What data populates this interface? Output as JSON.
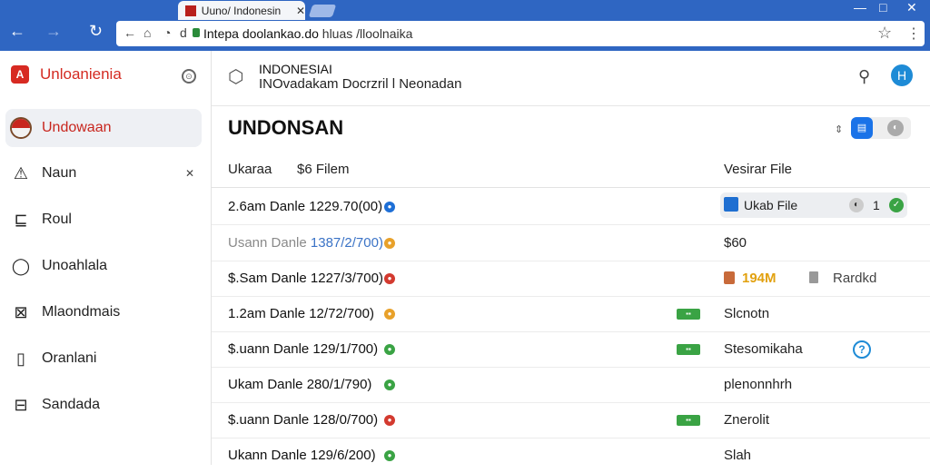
{
  "browser": {
    "tab_title": "Uuno/ Indonesin",
    "url_host": "Intepa doolankao.do",
    "url_path": " hluas /lloolnaika",
    "nav": {
      "back": "←",
      "forward": "→",
      "reload": "↻"
    },
    "window_controls": [
      "—",
      "□",
      "✕"
    ],
    "tab_close": "✕"
  },
  "sidebar": {
    "brand": "Unloanienia",
    "brand_icon": "logo-icon",
    "items": [
      {
        "label": "Undowaan",
        "icon": "flag-icon",
        "active": true
      },
      {
        "label": "Naun",
        "icon": "warning-icon",
        "extra": "✕"
      },
      {
        "label": "Roul",
        "icon": "chart-icon"
      },
      {
        "label": "Unoahlala",
        "icon": "chat-icon"
      },
      {
        "label": "Mlaondmais",
        "icon": "grid-icon"
      },
      {
        "label": "Oranlani",
        "icon": "document-icon"
      },
      {
        "label": "Sandada",
        "icon": "table-icon"
      }
    ]
  },
  "header": {
    "title": "INDONESIAI",
    "subtitle": "INOvadakam Docrzril l Neonadan"
  },
  "page": {
    "title": "UNDONSAN",
    "columns": {
      "name": "Ukaraa",
      "size": "$6 Filem",
      "file": "Vesirar File"
    }
  },
  "rows": [
    {
      "name": "2.6am Danle 1229.70(00)",
      "dot_color": "#1e6fd6",
      "file_chip": {
        "label": "Ukab File",
        "count": "1"
      }
    },
    {
      "name_prefix": "Usann Danle ",
      "name_highlight": "1387/2/700)",
      "muted": true,
      "dot_color": "#e8a12a",
      "file": "$60"
    },
    {
      "name": "$.Sam Danle 1227/3/700)",
      "dot_color": "#d33a2f",
      "size": "194M",
      "size2": "Rardkd"
    },
    {
      "name": "1.2am Danle 12/72/700)",
      "dot_color": "#e8a12a",
      "tag": "▪▪",
      "file": "Slcnotn"
    },
    {
      "name": "$.uann Danle 129/1/700)",
      "dot_color": "#3aa344",
      "tag": "▪▪",
      "file": "Stesomikaha",
      "help": "?"
    },
    {
      "name": "Ukam Danle 280/1/790)",
      "dot_color": "#3aa344",
      "file": "plenonnhrh"
    },
    {
      "name": "$.uann Danle 128/0/700)",
      "dot_color": "#d33a2f",
      "tag": "▪▪",
      "file": "Znerolit"
    },
    {
      "name": "Ukann Danle 129/6/200)",
      "dot_color": "#3aa344",
      "file": "Slah"
    }
  ]
}
